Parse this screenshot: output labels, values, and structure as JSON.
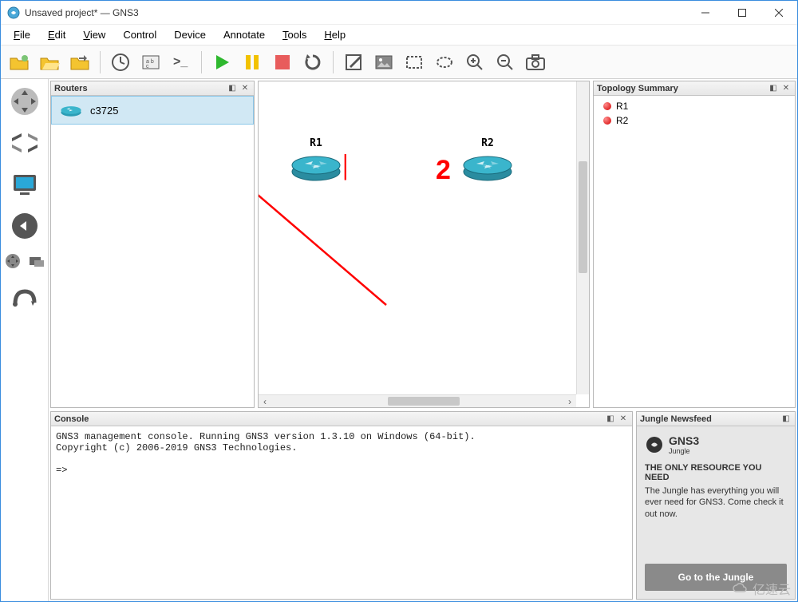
{
  "window": {
    "title": "Unsaved project* — GNS3"
  },
  "menu": {
    "file": "File",
    "edit": "Edit",
    "view": "View",
    "control": "Control",
    "device": "Device",
    "annotate": "Annotate",
    "tools": "Tools",
    "help": "Help"
  },
  "panels": {
    "routers": {
      "title": "Routers",
      "item": "c3725"
    },
    "topology": {
      "title": "Topology Summary",
      "items": [
        "R1",
        "R2"
      ]
    },
    "console": {
      "title": "Console",
      "line1": "GNS3 management console. Running GNS3 version 1.3.10 on Windows (64-bit).",
      "line2": "Copyright (c) 2006-2019 GNS3 Technologies.",
      "prompt": "=>"
    },
    "jungle": {
      "title": "Jungle Newsfeed",
      "brand": "GNS3",
      "sub": "Jungle",
      "headline": "THE ONLY RESOURCE YOU NEED",
      "desc": "The Jungle has everything you will ever need for GNS3. Come check it out now.",
      "button": "Go to the Jungle"
    }
  },
  "canvas": {
    "nodes": {
      "r1": "R1",
      "r2": "R2"
    },
    "marks": {
      "m1": "1",
      "m2": "2"
    }
  },
  "watermark": "亿速云"
}
